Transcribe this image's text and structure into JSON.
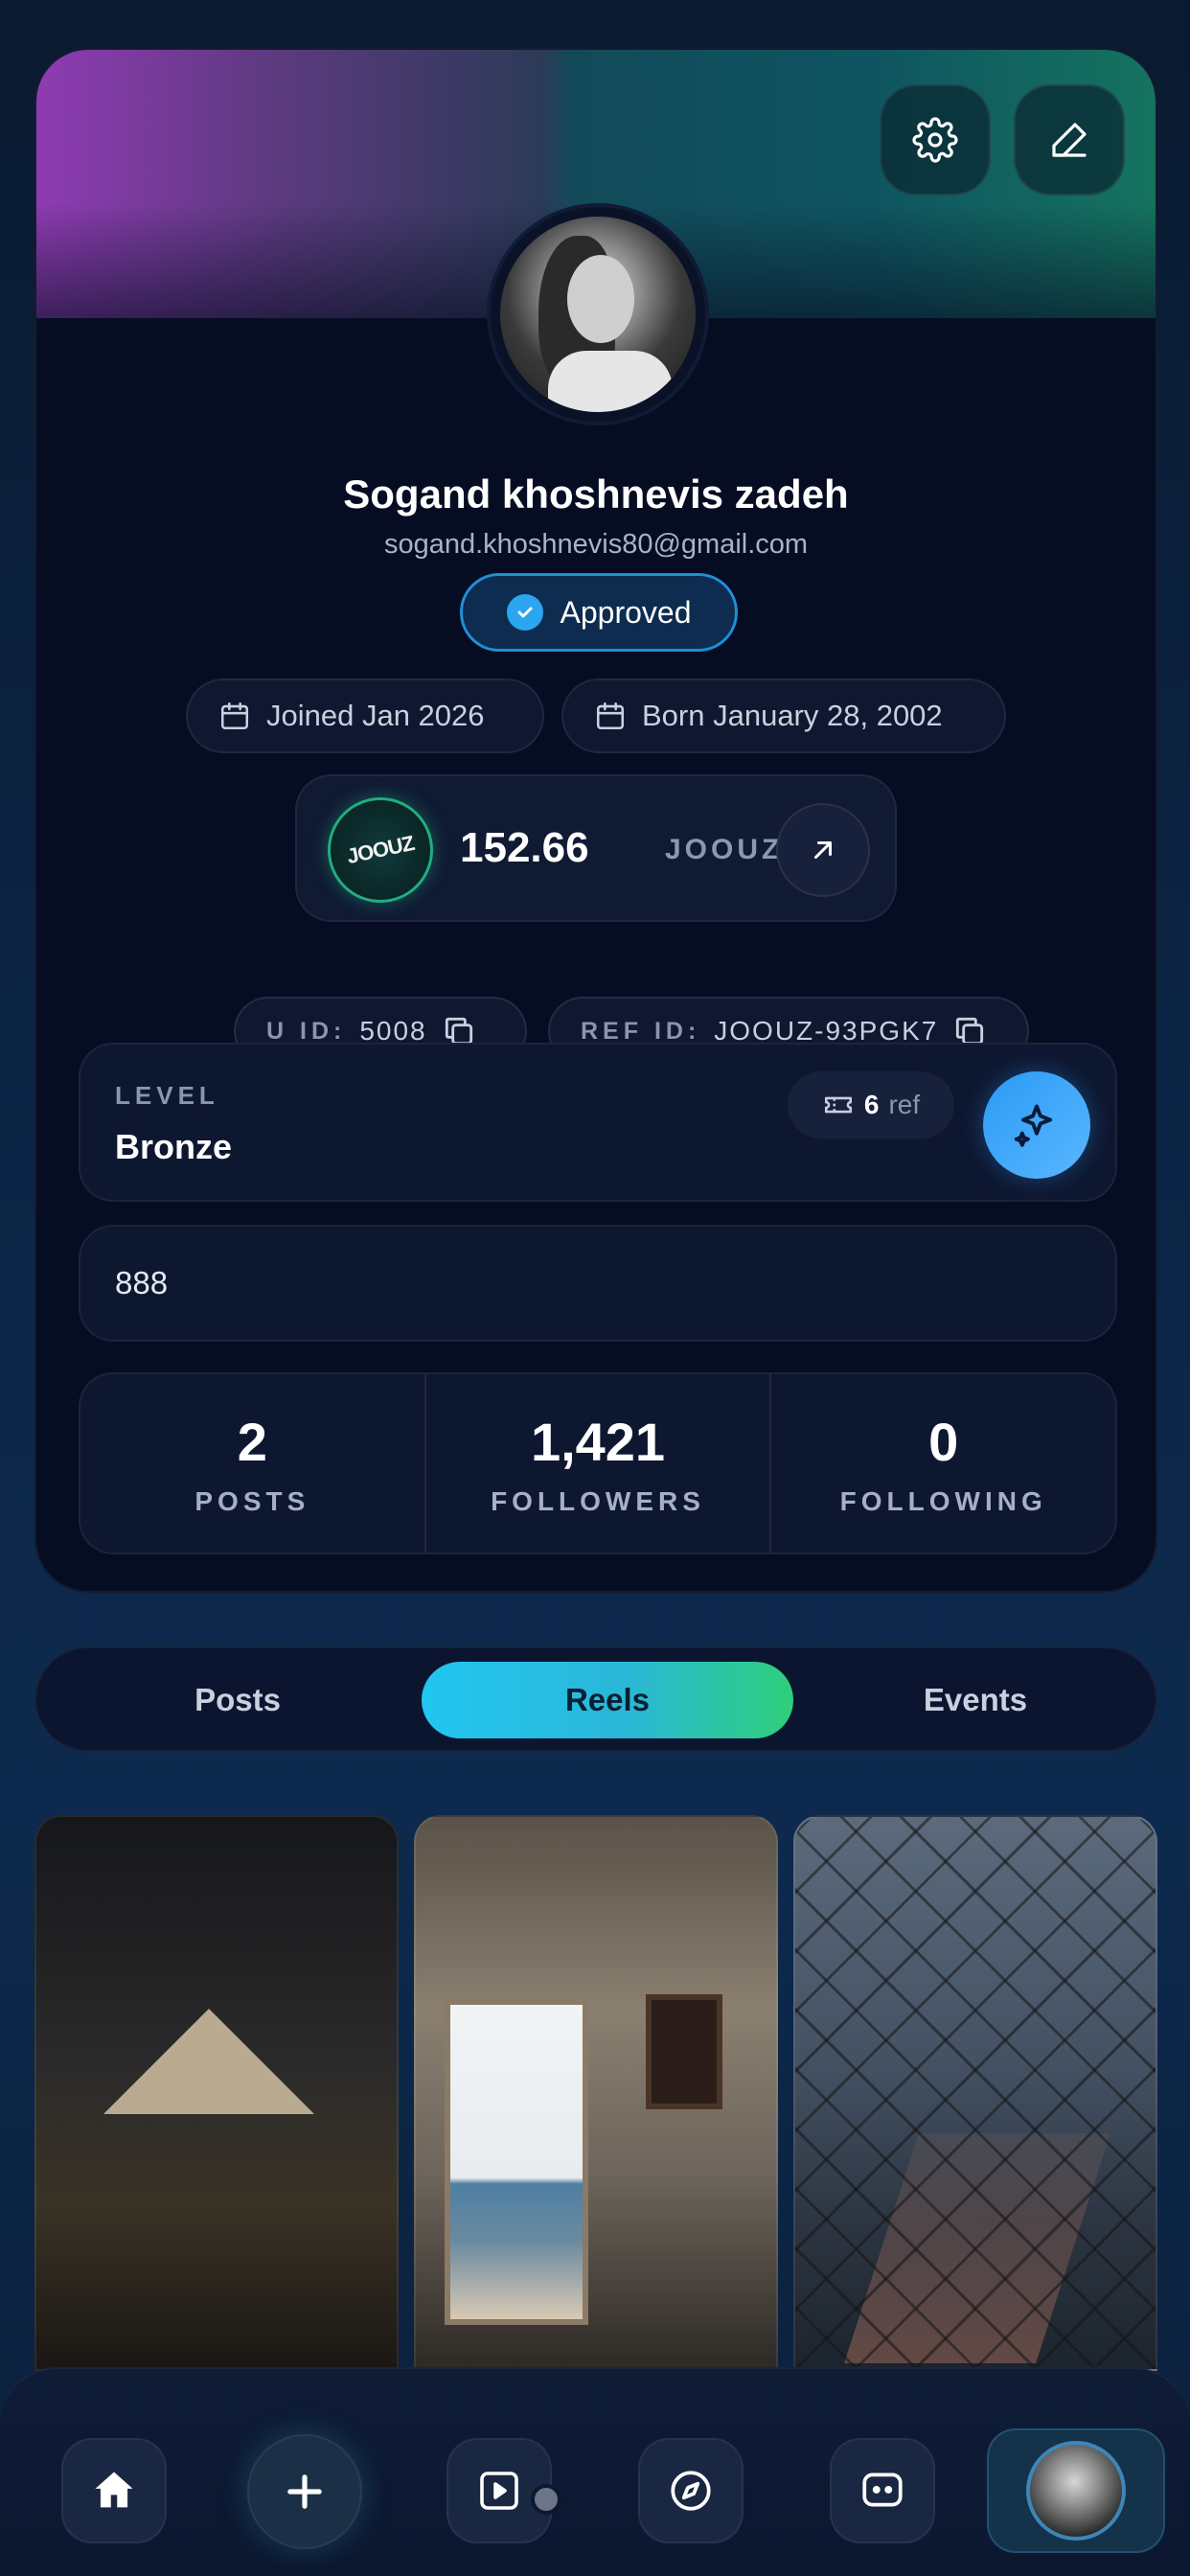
{
  "profile": {
    "name": "Sogand khoshnevis zadeh",
    "email": "sogand.khoshnevis80@gmail.com",
    "status_badge": "Approved",
    "joined": "Joined Jan 2026",
    "born": "Born January 28, 2002"
  },
  "wallet": {
    "logo_text": "JOOUZ",
    "amount": "152.66",
    "currency": "JOOUZ"
  },
  "ids": {
    "uid_label": "U ID:",
    "uid_value": "5008",
    "ref_label": "REF ID:",
    "ref_value": "JOOUZ-93PGK7"
  },
  "level": {
    "label": "LEVEL",
    "value": "Bronze",
    "ref_count": "6",
    "ref_unit": "ref"
  },
  "bio": "888",
  "stats": [
    {
      "value": "2",
      "label": "POSTS"
    },
    {
      "value": "1,421",
      "label": "FOLLOWERS"
    },
    {
      "value": "0",
      "label": "FOLLOWING"
    }
  ],
  "tabs": {
    "posts": "Posts",
    "reels": "Reels",
    "events": "Events",
    "active": "Reels"
  },
  "grid_tiles": [
    "pyramid-night-view",
    "bathroom-doorway-sea",
    "chain-fence-city"
  ],
  "bottom_nav": [
    "home-icon",
    "plus-icon",
    "play-square-icon",
    "compass-icon",
    "chat-bubble-icon",
    "profile-avatar"
  ],
  "colors": {
    "accent_blue": "#2a9bf5",
    "accent_teal": "#22c6f0",
    "accent_green": "#2fcf7a",
    "background": "#060d22"
  }
}
